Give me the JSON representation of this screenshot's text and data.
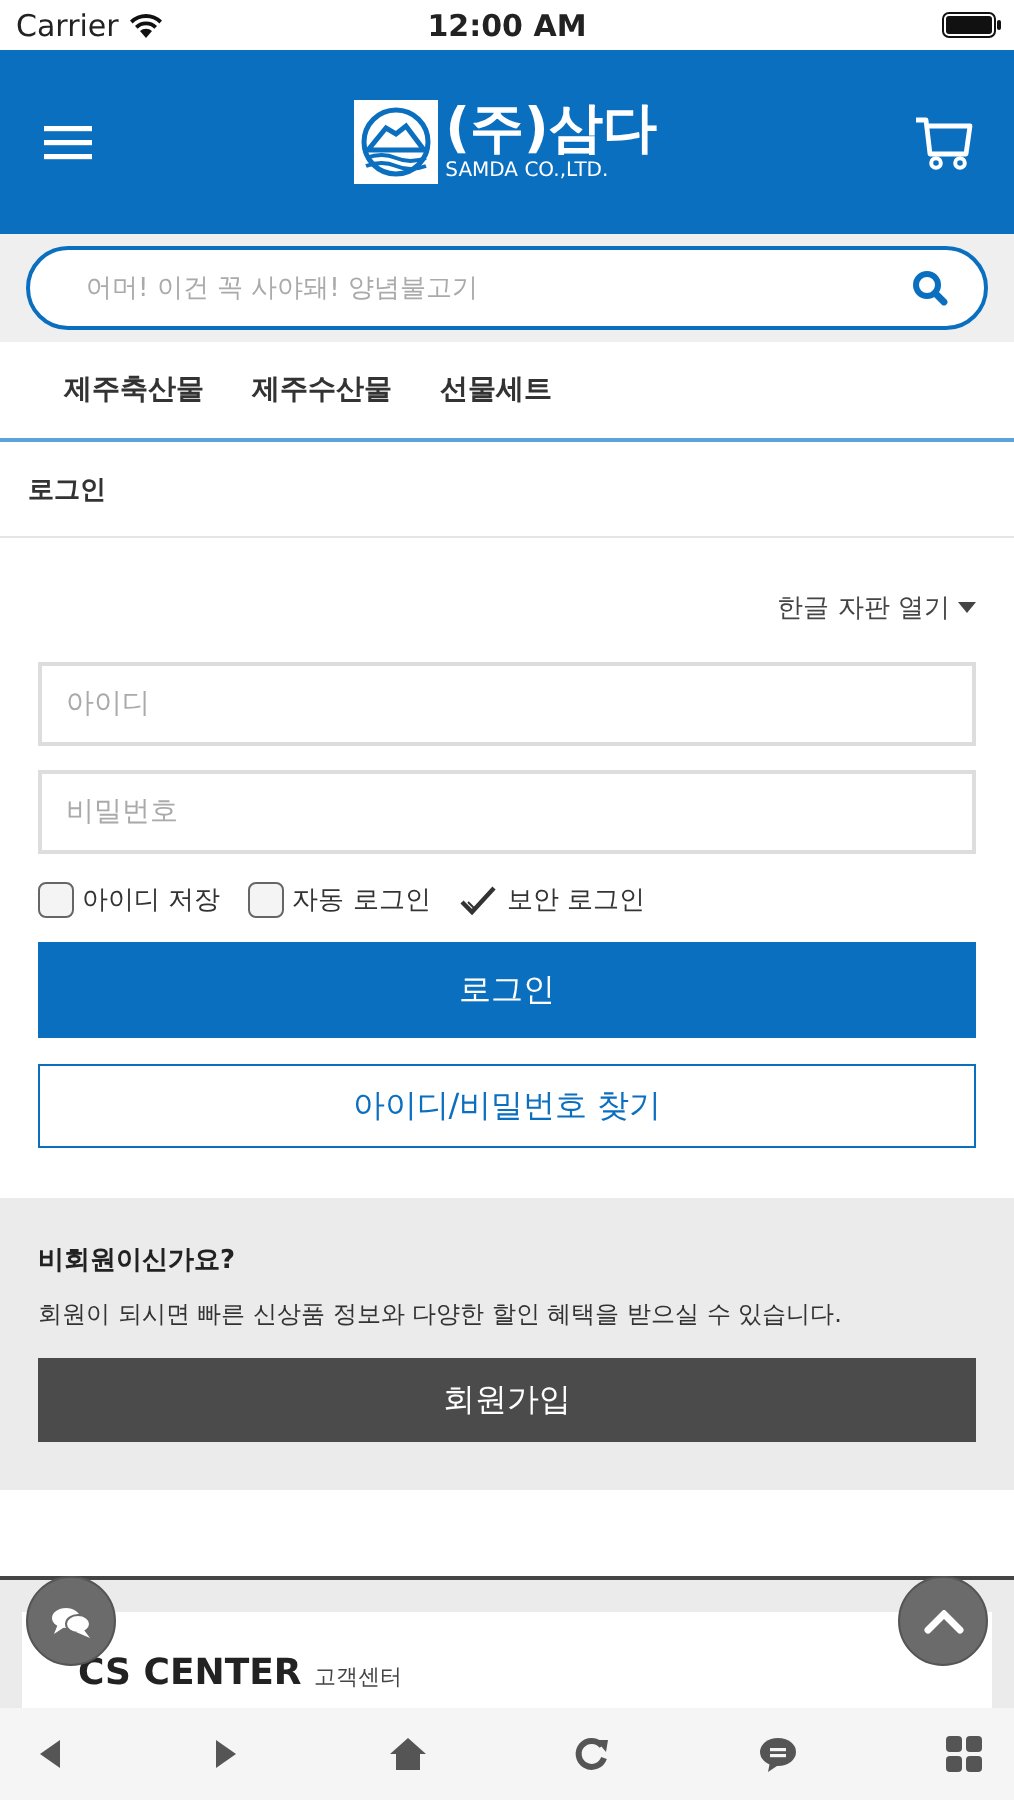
{
  "status_bar": {
    "carrier": "Carrier",
    "time": "12:00 AM"
  },
  "header": {
    "logo_title": "(주)삼다",
    "logo_subtitle": "SAMDA CO.,LTD."
  },
  "search": {
    "placeholder": "어머! 이건 꼭 사야돼! 양념불고기"
  },
  "nav": [
    "제주축산물",
    "제주수산물",
    "선물세트"
  ],
  "breadcrumb": "로그인",
  "keyboard_link": "한글 자판 열기",
  "login_form": {
    "id_placeholder": "아이디",
    "password_placeholder": "비밀번호",
    "options": [
      {
        "label": "아이디 저장",
        "kind": "box",
        "checked": false
      },
      {
        "label": "자동 로그인",
        "kind": "box",
        "checked": false
      },
      {
        "label": "보안 로그인",
        "kind": "tick",
        "checked": true
      }
    ],
    "login_button": "로그인",
    "find_button": "아이디/비밀번호 찾기"
  },
  "guest": {
    "title": "비회원이신가요?",
    "text": "회원이 되시면 빠른 신상품 정보와 다양한 할인 혜택을 받으실 수 있습니다.",
    "join_button": "회원가입"
  },
  "footer": {
    "title": "CS CENTER",
    "subtitle": "고객센터"
  }
}
